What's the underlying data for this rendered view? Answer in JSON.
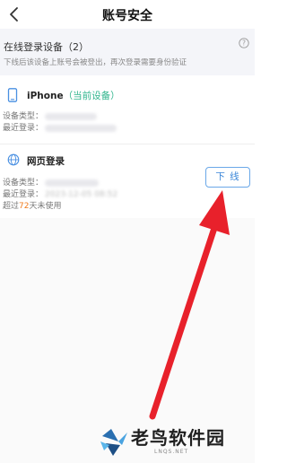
{
  "header": {
    "title": "账号安全"
  },
  "online_section": {
    "title": "在线登录设备（2）",
    "subtitle": "下线后该设备上账号会被登出，再次登录需要身份验证"
  },
  "devices": [
    {
      "name": "iPhone",
      "tag": "（当前设备）",
      "type_label": "设备类型：",
      "recent_label": "最近登录："
    },
    {
      "name": "网页登录",
      "type_label": "设备类型：",
      "recent_label": "最近登录：",
      "recent_value_blurred": "2023-12-05 08:52",
      "inactive_prefix": "超过",
      "inactive_days": "72",
      "inactive_suffix": "天未使用",
      "logout_label": "下 线"
    }
  ],
  "watermark": {
    "text": "老鸟软件园",
    "sub": "LNQS.NET"
  },
  "colors": {
    "current_device_tag": "#2fb48c",
    "logout_button": "#3a86d8",
    "inactive_days": "#f07b1d",
    "arrow": "#e8212b"
  },
  "icons": [
    "back-icon",
    "help-icon",
    "phone-icon",
    "globe-icon",
    "bird-logo-icon"
  ]
}
